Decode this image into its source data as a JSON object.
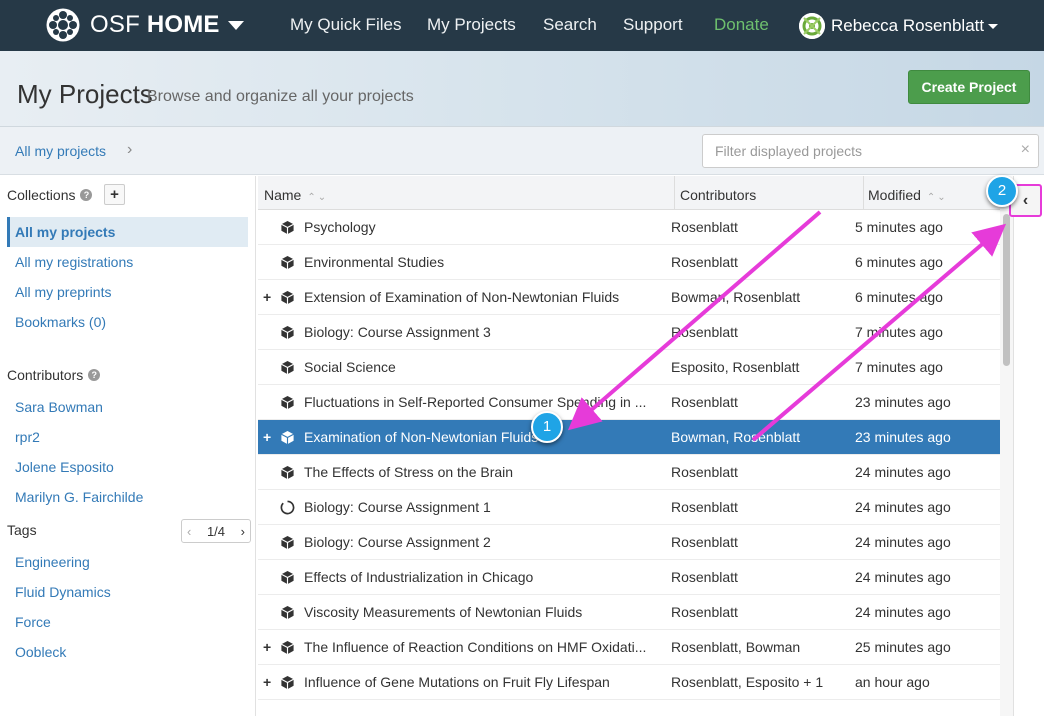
{
  "nav": {
    "brand_prefix": "OSF",
    "brand_bold": "HOME",
    "links": [
      "My Quick Files",
      "My Projects",
      "Search",
      "Support",
      "Donate"
    ],
    "user_name": "Rebecca Rosenblatt"
  },
  "header": {
    "title": "My Projects",
    "subtitle": "Browse and organize all your projects",
    "create_label": "Create Project"
  },
  "breadcrumb": {
    "label": "All my projects",
    "separator": "›"
  },
  "filter": {
    "placeholder": "Filter displayed projects",
    "clear": "×"
  },
  "sidebar": {
    "collections_heading": "Collections",
    "help": "?",
    "add": "+",
    "collections": [
      "All my projects",
      "All my registrations",
      "All my preprints",
      "Bookmarks (0)"
    ],
    "contributors_heading": "Contributors",
    "contributors": [
      "Sara Bowman",
      "rpr2",
      "Jolene Esposito",
      "Marilyn G. Fairchilde"
    ],
    "tags_heading": "Tags",
    "tags_pager": {
      "prev": "‹",
      "label": "1/4",
      "next": "›"
    },
    "tags": [
      "Engineering",
      "Fluid Dynamics",
      "Force",
      "Oobleck"
    ]
  },
  "table": {
    "columns": [
      "Name",
      "Contributors",
      "Modified"
    ],
    "sort_glyph": "⌃⌄",
    "rows": [
      {
        "expandable": false,
        "name": "Psychology",
        "contributors": "Rosenblatt",
        "modified": "5 minutes ago"
      },
      {
        "expandable": false,
        "name": "Environmental Studies",
        "contributors": "Rosenblatt",
        "modified": "6 minutes ago"
      },
      {
        "expandable": true,
        "name": "Extension of Examination of Non-Newtonian Fluids",
        "contributors": "Bowman, Rosenblatt",
        "modified": "6 minutes ago"
      },
      {
        "expandable": false,
        "name": "Biology: Course Assignment 3",
        "contributors": "Rosenblatt",
        "modified": "7 minutes ago"
      },
      {
        "expandable": false,
        "name": "Social Science",
        "contributors": "Esposito, Rosenblatt",
        "modified": "7 minutes ago"
      },
      {
        "expandable": false,
        "name": "Fluctuations in Self-Reported Consumer Spending in ...",
        "contributors": "Rosenblatt",
        "modified": "23 minutes ago"
      },
      {
        "expandable": true,
        "name": "Examination of Non-Newtonian Fluids",
        "contributors": "Bowman, Rosenblatt",
        "modified": "23 minutes ago",
        "selected": true
      },
      {
        "expandable": false,
        "name": "The Effects of Stress on the Brain",
        "contributors": "Rosenblatt",
        "modified": "24 minutes ago"
      },
      {
        "expandable": false,
        "name": "Biology: Course Assignment 1",
        "contributors": "Rosenblatt",
        "modified": "24 minutes ago",
        "loading": true
      },
      {
        "expandable": false,
        "name": "Biology: Course Assignment 2",
        "contributors": "Rosenblatt",
        "modified": "24 minutes ago"
      },
      {
        "expandable": false,
        "name": "Effects of Industrialization in Chicago",
        "contributors": "Rosenblatt",
        "modified": "24 minutes ago"
      },
      {
        "expandable": false,
        "name": "Viscosity Measurements of Newtonian Fluids",
        "contributors": "Rosenblatt",
        "modified": "24 minutes ago"
      },
      {
        "expandable": true,
        "name": "The Influence of Reaction Conditions on HMF Oxidati...",
        "contributors": "Rosenblatt, Bowman",
        "modified": "25 minutes ago"
      },
      {
        "expandable": true,
        "name": "Influence of Gene Mutations on Fruit Fly Lifespan",
        "contributors": "Rosenblatt, Esposito + 1",
        "modified": "an hour ago"
      }
    ]
  },
  "collapse": {
    "glyph": "‹"
  },
  "callouts": [
    "1",
    "2"
  ],
  "colors": {
    "nav_bg": "#263947",
    "accent": "#337ab7",
    "create": "#4c9d4c",
    "donate": "#6ec06e",
    "annotation": "#e63bd9",
    "callout": "#1fa4e6"
  }
}
